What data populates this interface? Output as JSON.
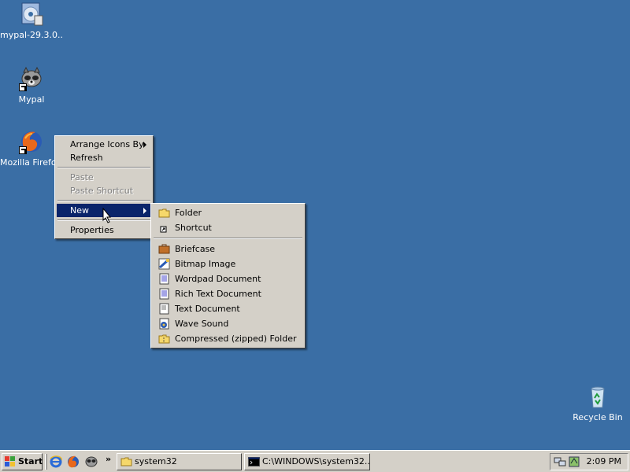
{
  "desktop": {
    "icons": [
      {
        "label": "mypal-29.3.0..."
      },
      {
        "label": "Mypal"
      },
      {
        "label": "Mozilla Firefox"
      },
      {
        "label": "Recycle Bin"
      }
    ]
  },
  "context_menu": {
    "items": [
      {
        "label": "Arrange Icons By"
      },
      {
        "label": "Refresh"
      },
      {
        "label": "Paste"
      },
      {
        "label": "Paste Shortcut"
      },
      {
        "label": "New"
      },
      {
        "label": "Properties"
      }
    ]
  },
  "new_submenu": {
    "items": [
      {
        "label": "Folder"
      },
      {
        "label": "Shortcut"
      },
      {
        "label": "Briefcase"
      },
      {
        "label": "Bitmap Image"
      },
      {
        "label": "Wordpad Document"
      },
      {
        "label": "Rich Text Document"
      },
      {
        "label": "Text Document"
      },
      {
        "label": "Wave Sound"
      },
      {
        "label": "Compressed (zipped) Folder"
      }
    ]
  },
  "taskbar": {
    "start_label": "Start",
    "more_label": "»",
    "tasks": [
      {
        "label": "system32"
      },
      {
        "label": "C:\\WINDOWS\\system32..."
      }
    ],
    "clock": "2:09 PM"
  },
  "colors": {
    "desktop": "#3a6ea5",
    "menu_highlight": "#0a246a",
    "face": "#d4d0c8"
  }
}
